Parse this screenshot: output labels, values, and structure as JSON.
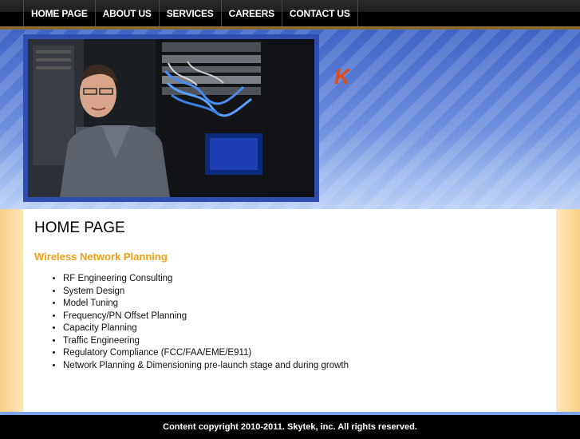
{
  "nav": {
    "items": [
      {
        "label": "HOME PAGE"
      },
      {
        "label": "ABOUT US"
      },
      {
        "label": "SERVICES"
      },
      {
        "label": "CAREERS"
      },
      {
        "label": "CONTACT US"
      }
    ]
  },
  "header": {
    "logo_letter": "K",
    "photo_icon": "network-engineer-photo"
  },
  "content": {
    "title": "HOME PAGE",
    "section_heading": "Wireless Network Planning",
    "items": [
      "RF Engineering Consulting",
      "System Design",
      "Model Tuning",
      "Frequency/PN Offset Planning",
      "Capacity Planning",
      "Traffic Engineering",
      "Regulatory Compliance (FCC/FAA/EME/E911)",
      "Network Planning & Dimensioning pre-launch stage and during growth"
    ]
  },
  "footer": {
    "copyright": "Content copyright 2010-2011. Skytek, inc. All rights reserved."
  },
  "colors": {
    "accent_orange": "#f0a014",
    "logo_red": "#e54a10",
    "header_blue": "#3f64c6"
  }
}
